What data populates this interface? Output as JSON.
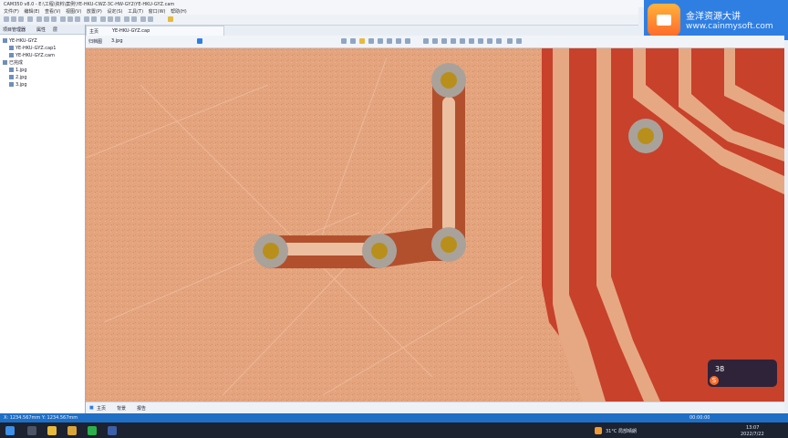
{
  "window": {
    "title": "CAM350 v8.0 - E:\\工程\\资料\\案例\\YE-HKU-CWZ-3C-HW-GY2\\YE-HKU-GYZ.cam"
  },
  "menu": [
    "文件(F)",
    "编辑(E)",
    "查看(V)",
    "视图(V)",
    "放置(P)",
    "设定(S)",
    "工具(T)",
    "窗口(W)",
    "帮助(H)"
  ],
  "left_panel": {
    "tabs": [
      "项目管理器",
      "属性",
      "层"
    ],
    "tree": [
      "YE-HKU-GYZ",
      "YE-HKU-GYZ.cap1",
      "YE-HKU-GYZ.cam",
      "已完成",
      "1.jpg",
      "2.jpg",
      "3.jpg"
    ]
  },
  "doc_tab": {
    "label": "YE-HKU-GYZ.cap",
    "prefix": "主页"
  },
  "view_bar": {
    "label": "归档图",
    "sub": "3.jpg"
  },
  "bottom_tabs": [
    "主页",
    "背景",
    "报告"
  ],
  "status": {
    "coords": "X: 1234.567mm  Y: 1234.567mm",
    "timer": "00:00:00"
  },
  "logo": {
    "line1": "金洋资源大讲",
    "line2": "www.cainmysoft.com"
  },
  "overlay": {
    "value": "38"
  },
  "taskbar": {
    "weather": "31°C 局部晴朗",
    "time": "13:07",
    "date": "2022/7/22"
  },
  "colors": {
    "board": "#e3a47e",
    "trace": "#c8412a",
    "pad": "#b98f1c",
    "status": "#1f6fc5"
  }
}
